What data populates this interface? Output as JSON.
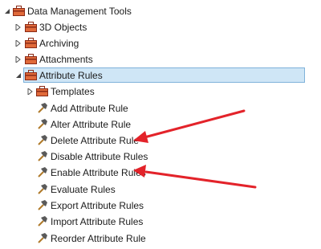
{
  "tree": {
    "root": {
      "label": "Data Management Tools",
      "icon": "toolbox-icon",
      "expanded": true
    },
    "children": [
      {
        "label": "3D Objects",
        "icon": "toolbox-icon",
        "expanded": false
      },
      {
        "label": "Archiving",
        "icon": "toolbox-icon",
        "expanded": false
      },
      {
        "label": "Attachments",
        "icon": "toolbox-icon",
        "expanded": false
      },
      {
        "label": "Attribute Rules",
        "icon": "toolbox-icon",
        "expanded": true,
        "selected": true
      }
    ],
    "attribute_rules": {
      "toolset": {
        "label": "Templates",
        "icon": "toolbox-icon",
        "expanded": false
      },
      "tools": [
        {
          "label": "Add Attribute Rule",
          "icon": "hammer-icon"
        },
        {
          "label": "Alter Attribute Rule",
          "icon": "hammer-icon"
        },
        {
          "label": "Delete Attribute Rule",
          "icon": "hammer-icon"
        },
        {
          "label": "Disable Attribute Rules",
          "icon": "hammer-icon"
        },
        {
          "label": "Enable Attribute Rules",
          "icon": "hammer-icon"
        },
        {
          "label": "Evaluate Rules",
          "icon": "hammer-icon"
        },
        {
          "label": "Export Attribute Rules",
          "icon": "hammer-icon"
        },
        {
          "label": "Import Attribute Rules",
          "icon": "hammer-icon"
        },
        {
          "label": "Reorder Attribute Rule",
          "icon": "hammer-icon"
        }
      ]
    }
  },
  "annotations": {
    "arrow_color": "#e3232a",
    "arrows": [
      {
        "points_to": "Delete Attribute Rule",
        "icon": "red-arrow-icon"
      },
      {
        "points_to": "Enable Attribute Rules",
        "icon": "red-arrow-icon"
      }
    ]
  },
  "colors": {
    "selection_fill": "#cfe6f6",
    "selection_border": "#7fb2da",
    "toolbox_red": "#c8372d",
    "hammer_head": "#5a5a5a",
    "hammer_handle": "#b07a2a"
  }
}
